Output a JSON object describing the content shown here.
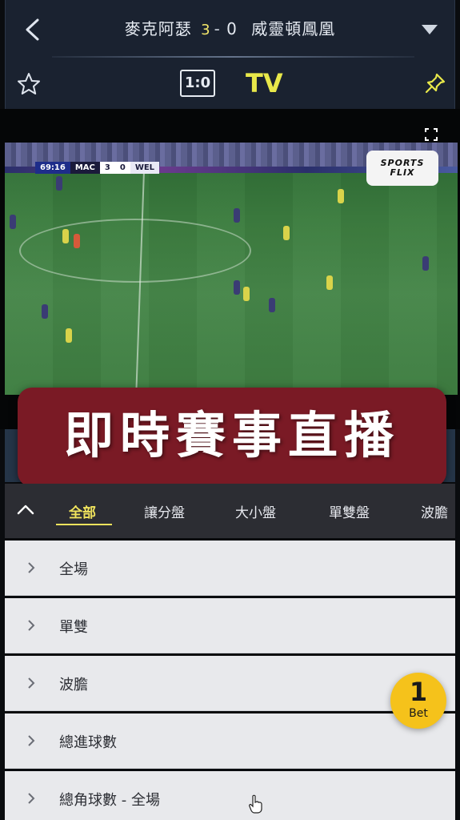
{
  "header": {
    "home_team": "麥克阿瑟",
    "home_score": "3",
    "score_separator": "-",
    "away_score": "0",
    "away_team": "威靈頓鳳凰",
    "scoreboard_label": "1:0",
    "tv_label": "TV"
  },
  "video": {
    "scorebug": {
      "time": "69:16",
      "home": "MAC",
      "home_score": "3",
      "away_score": "0",
      "away": "WEL"
    },
    "logo_line1": "SPORTS",
    "logo_line2": "FLIX"
  },
  "promo": {
    "text": "即時賽事直播"
  },
  "tabs": [
    {
      "label": "全部",
      "active": true
    },
    {
      "label": "讓分盤"
    },
    {
      "label": "大小盤"
    },
    {
      "label": "單雙盤"
    },
    {
      "label": "波膽"
    }
  ],
  "markets": [
    {
      "label": "全場"
    },
    {
      "label": "單雙"
    },
    {
      "label": "波膽"
    },
    {
      "label": "總進球數"
    },
    {
      "label": "總角球數 - 全場"
    }
  ],
  "bet_slip": {
    "count": "1",
    "label": "Bet",
    "color": "#f5c21b"
  },
  "colors": {
    "accent_yellow": "#f0e35d",
    "header_bg": "#1a2230",
    "promo_bg": "#7a1a25"
  }
}
